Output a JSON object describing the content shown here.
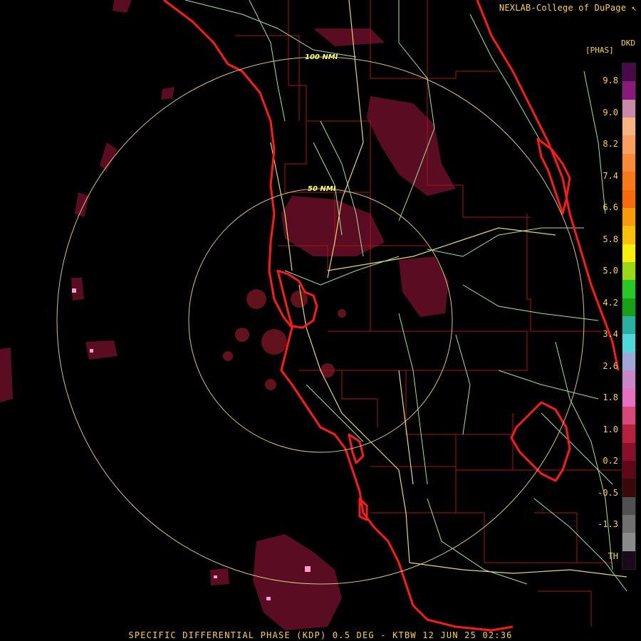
{
  "header": {
    "credit": "NEXLAB-College of DuPage",
    "product_code": "DKD",
    "units": "[PHAS]"
  },
  "map": {
    "range_rings": [
      {
        "label": "100 NMI"
      },
      {
        "label": "50 NMI"
      }
    ],
    "colors": {
      "coast": "#ff1a1a",
      "county_lines": "#a81414",
      "highways": "#e6d86a",
      "roads": "#9ae6a0",
      "rings": "#d8c47a",
      "echo": "#6a0f28",
      "echo_bright": "#ff9ad0"
    }
  },
  "legend": {
    "ticks": [
      "9.8",
      "9.0",
      "8.2",
      "7.4",
      "6.6",
      "5.8",
      "5.0",
      "4.2",
      "3.4",
      "2.6",
      "1.8",
      "1.0",
      "0.2",
      "-0.5",
      "-1.3",
      "TH"
    ],
    "colors": [
      "#4a0a4a",
      "#8a1a7a",
      "#c88aa8",
      "#f8b480",
      "#f8a060",
      "#f88a3a",
      "#f8781a",
      "#f86a0a",
      "#f89a0a",
      "#f8c00a",
      "#f8f00a",
      "#9ad818",
      "#28c828",
      "#18a018",
      "#2ab0a0",
      "#50d8d8",
      "#a0a8d8",
      "#c888c8",
      "#e870c0",
      "#d84878",
      "#b82040",
      "#881028",
      "#600818",
      "#3a0a0a",
      "#505050",
      "#707070",
      "#8a8a8a",
      "#1a0a1a"
    ]
  },
  "caption": "SPECIFIC DIFFERENTIAL PHASE (KDP) 0.5 DEG - KTBW 12 JUN 25 02:36"
}
